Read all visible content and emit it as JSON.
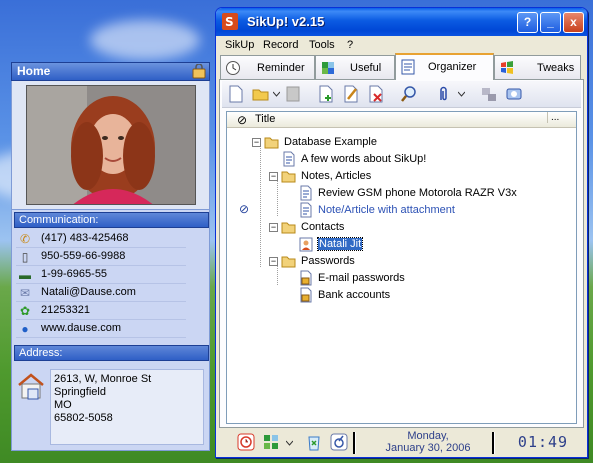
{
  "card": {
    "title": "Home",
    "communication_label": "Communication:",
    "communication": [
      {
        "icon": "phone-icon",
        "text": "(417) 483-425468"
      },
      {
        "icon": "mobile-phone-icon",
        "text": "950-559-66-9988"
      },
      {
        "icon": "fax-icon",
        "text": "1-99-6965-55"
      },
      {
        "icon": "email-icon",
        "text": "Natali@Dause.com"
      },
      {
        "icon": "icq-icon",
        "text": "21253321"
      },
      {
        "icon": "web-globe-icon",
        "text": "www.dause.com"
      }
    ],
    "address_label": "Address:",
    "address_lines": [
      "2613, W, Monroe St",
      "Springfield",
      "MO",
      "65802-5058"
    ]
  },
  "window": {
    "title": "SikUp! v2.15",
    "controls": [
      "?",
      "_",
      "x"
    ]
  },
  "menu": [
    "SikUp",
    "Record",
    "Tools",
    "?"
  ],
  "tabs": [
    {
      "label": "Reminder",
      "icon": "clock-icon",
      "active": false
    },
    {
      "label": "Useful",
      "icon": "puzzle-icon",
      "active": false
    },
    {
      "label": "Organizer",
      "icon": "notebook-icon",
      "active": true
    },
    {
      "label": "Tweaks",
      "icon": "windows-flag-icon",
      "active": false
    }
  ],
  "tree": {
    "column_title": "Title",
    "column_more": "...",
    "nodes": [
      {
        "text": "Database Example",
        "kind": "folder",
        "expanded": true,
        "level": 0
      },
      {
        "text": "A few words about SikUp!",
        "kind": "document",
        "level": 1
      },
      {
        "text": "Notes, Articles",
        "kind": "folder",
        "expanded": true,
        "level": 1
      },
      {
        "text": "Review GSM phone Motorola RAZR V3x",
        "kind": "document",
        "level": 2
      },
      {
        "text": "Note/Article with attachment",
        "kind": "document",
        "level": 2,
        "attachment": true
      },
      {
        "text": "Contacts",
        "kind": "folder",
        "expanded": true,
        "level": 1
      },
      {
        "text": "Natali Jit",
        "kind": "contact",
        "level": 2,
        "selected": true
      },
      {
        "text": "Passwords",
        "kind": "folder",
        "expanded": true,
        "level": 1
      },
      {
        "text": "E-mail passwords",
        "kind": "locked",
        "level": 2
      },
      {
        "text": "Bank accounts",
        "kind": "locked",
        "level": 2
      }
    ]
  },
  "status": {
    "date_line1": "Monday,",
    "date_line2": "January 30, 2006",
    "time": "01:49"
  },
  "colors": {
    "titlebar": "#0b5be2",
    "selection": "#316ac5",
    "link": "#2d52b5",
    "card_header": "#2f5fc6"
  }
}
